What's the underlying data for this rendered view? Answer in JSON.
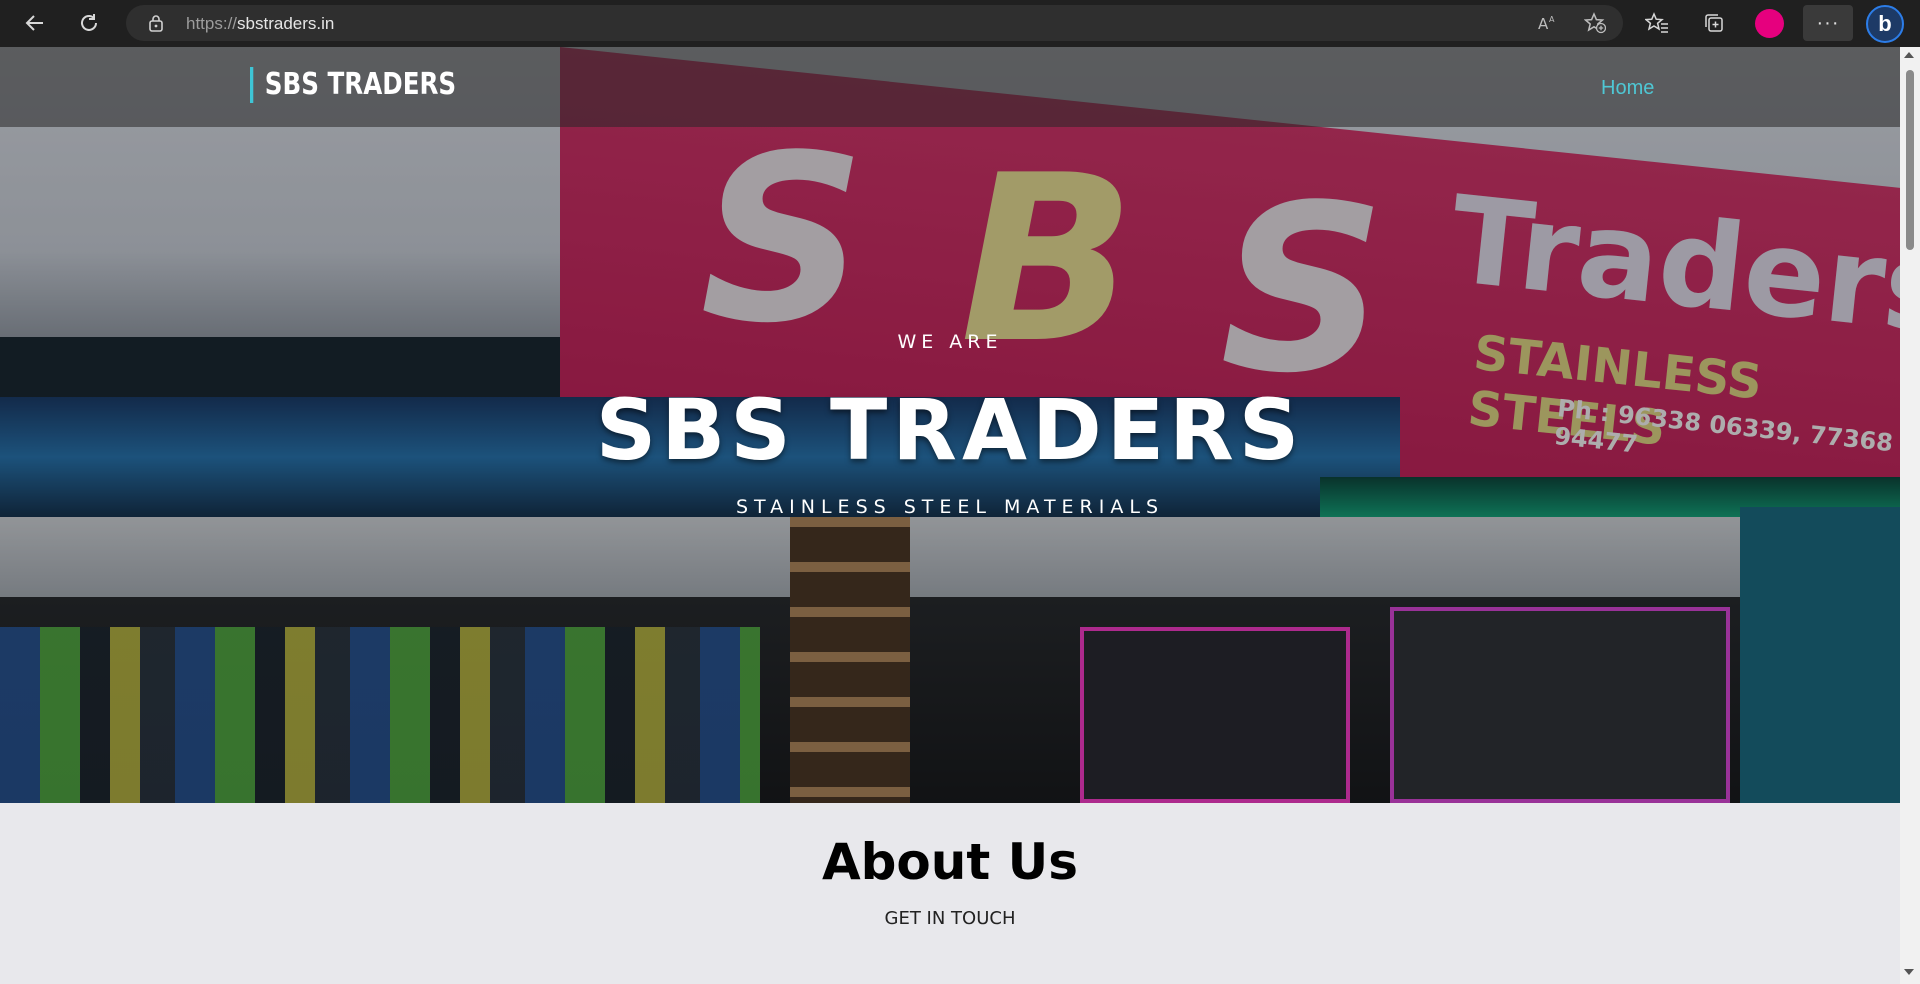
{
  "browser": {
    "url_protocol": "https://",
    "url_host": "sbstraders.in",
    "accent_profile_color": "#e6007e",
    "more_label": "···",
    "bing_label": "b"
  },
  "site": {
    "brand": "SBS TRADERS",
    "nav": {
      "home_label": "Home"
    },
    "hero": {
      "kicker": "WE ARE",
      "title": "SBS TRADERS",
      "subtitle": "STAINLESS STEEL MATERIALS",
      "sign": {
        "letters": [
          "S",
          "B",
          "S"
        ],
        "traders": "Traders",
        "stainless_steels": "STAINLESS STEELS",
        "phone": "Ph : 96338 06339, 77368 94477"
      }
    },
    "about": {
      "title": "About Us",
      "subtitle": "GET IN TOUCH"
    },
    "colors": {
      "accent": "#3ec5d6",
      "nav_link": "#4fc7d4",
      "about_bg": "#e8e8ec"
    }
  }
}
